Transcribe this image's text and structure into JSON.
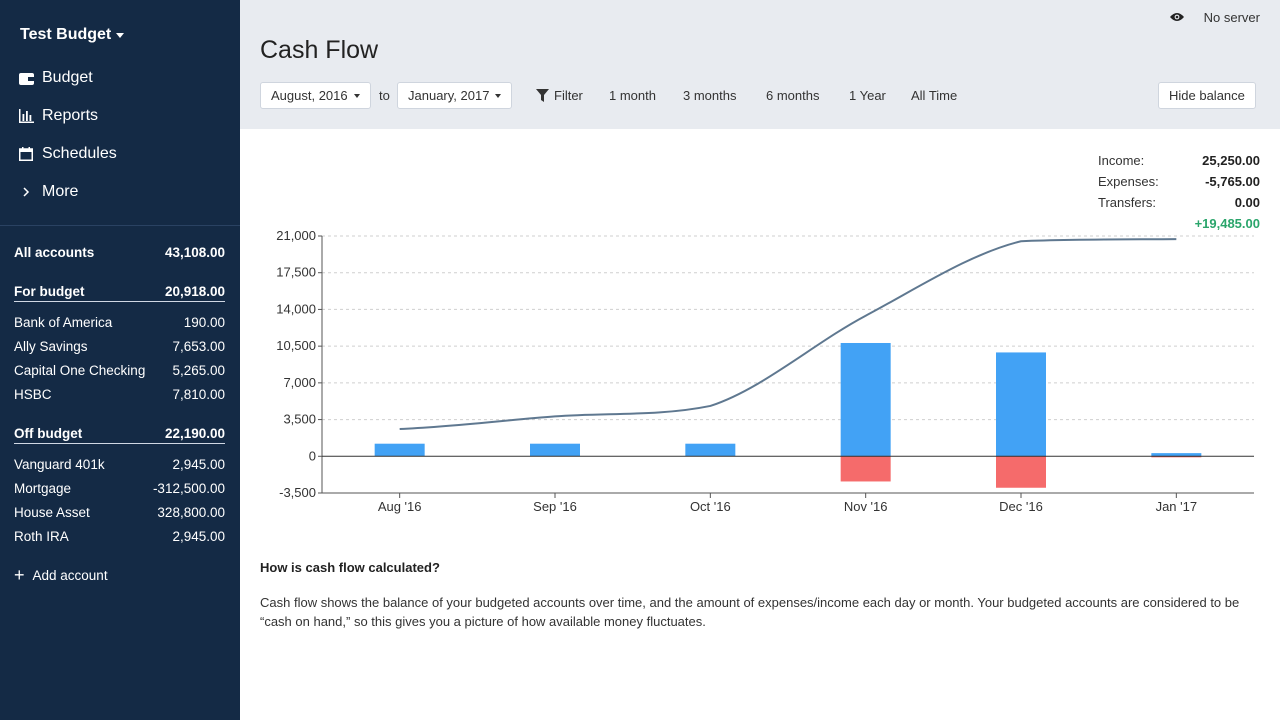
{
  "sidebar": {
    "budget_name": "Test Budget",
    "nav": [
      {
        "label": "Budget",
        "icon": "wallet-icon"
      },
      {
        "label": "Reports",
        "icon": "bar-chart-icon"
      },
      {
        "label": "Schedules",
        "icon": "calendar-icon"
      },
      {
        "label": "More",
        "icon": "chevron-right-icon"
      }
    ],
    "all_accounts": {
      "label": "All accounts",
      "value": "43,108.00"
    },
    "for_budget": {
      "label": "For budget",
      "value": "20,918.00"
    },
    "budget_accounts": [
      {
        "name": "Bank of America",
        "value": "190.00"
      },
      {
        "name": "Ally Savings",
        "value": "7,653.00"
      },
      {
        "name": "Capital One Checking",
        "value": "5,265.00"
      },
      {
        "name": "HSBC",
        "value": "7,810.00"
      }
    ],
    "off_budget": {
      "label": "Off budget",
      "value": "22,190.00"
    },
    "offbudget_accounts": [
      {
        "name": "Vanguard 401k",
        "value": "2,945.00"
      },
      {
        "name": "Mortgage",
        "value": "-312,500.00"
      },
      {
        "name": "House Asset",
        "value": "328,800.00"
      },
      {
        "name": "Roth IRA",
        "value": "2,945.00"
      }
    ],
    "add_account": "Add account"
  },
  "header": {
    "server_status": "No server",
    "title": "Cash Flow",
    "start_date": "August, 2016",
    "to": "to",
    "end_date": "January, 2017",
    "filter": "Filter",
    "ranges": [
      "1 month",
      "3 months",
      "6 months",
      "1 Year",
      "All Time"
    ],
    "hide_balance": "Hide balance"
  },
  "summary": {
    "income_label": "Income:",
    "income": "25,250.00",
    "expenses_label": "Expenses:",
    "expenses": "-5,765.00",
    "transfers_label": "Transfers:",
    "transfers": "0.00",
    "total": "+19,485.00"
  },
  "colors": {
    "income": "#42a2f5",
    "expense": "#f56b6b",
    "balance_line": "#5f7890",
    "positive": "#2aa56b",
    "sidebar": "#142a45"
  },
  "chart_data": {
    "type": "bar",
    "categories": [
      "Aug '16",
      "Sep '16",
      "Oct '16",
      "Nov '16",
      "Dec '16",
      "Jan '17"
    ],
    "series": [
      {
        "values": [
          1200,
          1200,
          1200,
          10800,
          9900,
          300
        ]
      },
      {
        "values": [
          0,
          0,
          0,
          -2400,
          -3000,
          -100
        ]
      },
      {
        "values": [
          2600,
          3800,
          4800,
          13400,
          20500,
          20700
        ]
      }
    ],
    "yticks": [
      21000,
      17500,
      14000,
      10500,
      7000,
      3500,
      0,
      -3500
    ],
    "ytick_labels": [
      "21,000",
      "17,500",
      "14,000",
      "10,500",
      "7,000",
      "3,500",
      "0",
      "-3,500"
    ],
    "ylim": [
      -3500,
      21000
    ]
  },
  "help": {
    "title": "How is cash flow calculated?",
    "body": "Cash flow shows the balance of your budgeted accounts over time, and the amount of expenses/income each day or month. Your budgeted accounts are considered to be “cash on hand,” so this gives you a picture of how available money fluctuates."
  }
}
